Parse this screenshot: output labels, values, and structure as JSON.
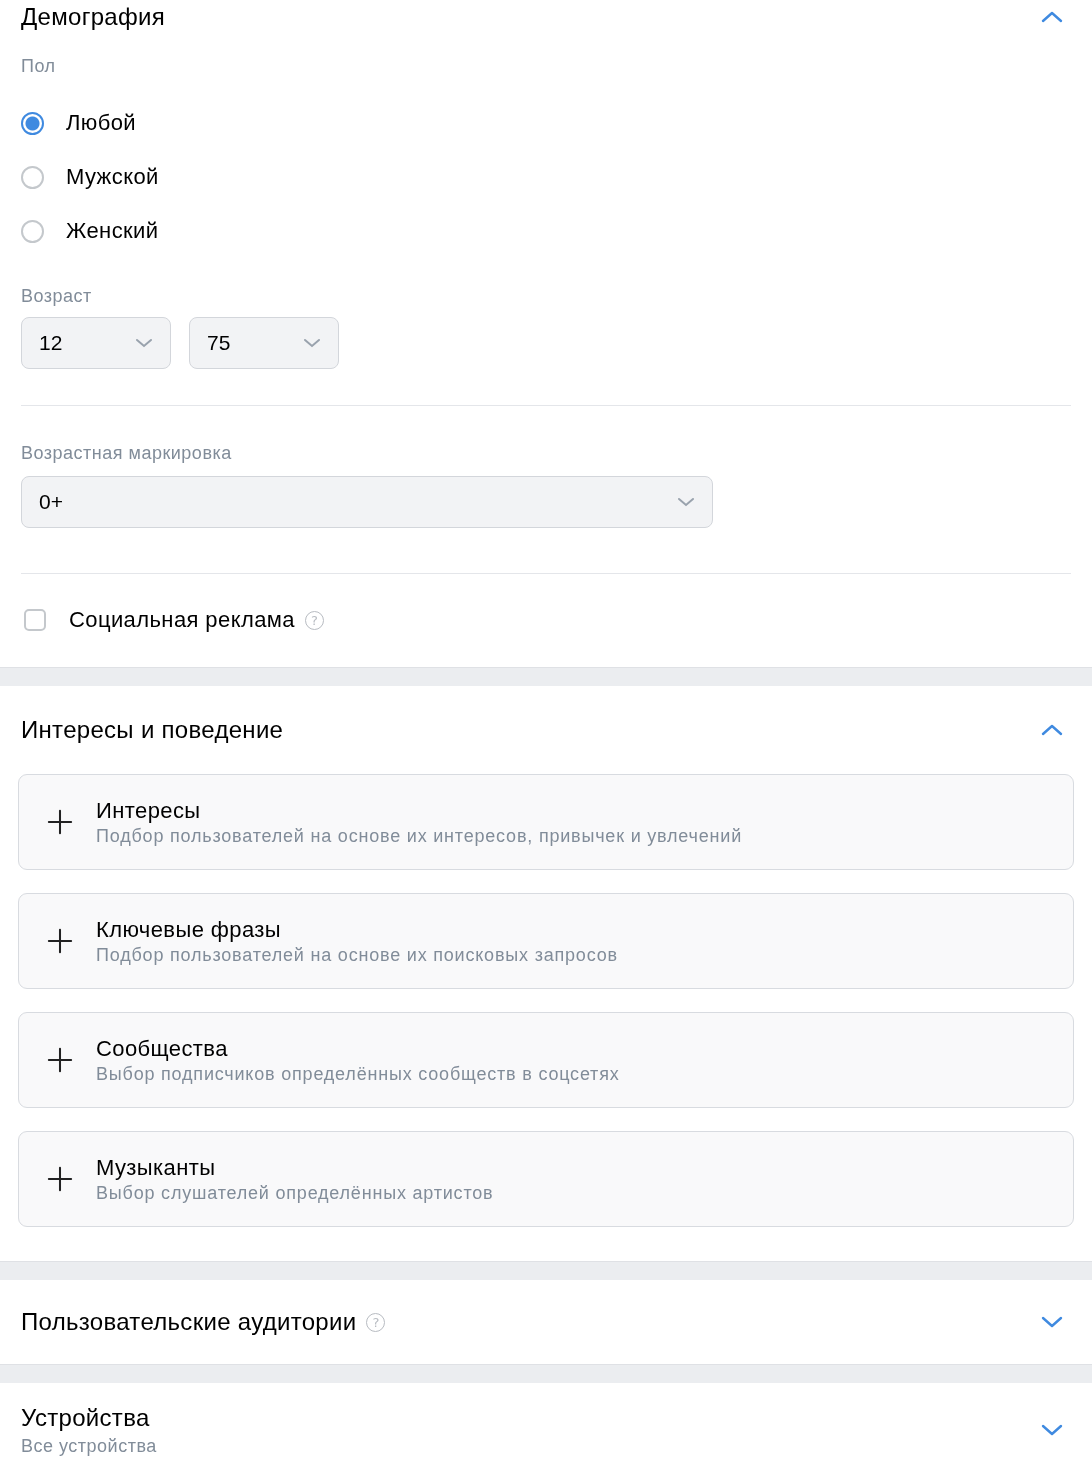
{
  "sections": [
    {
      "kind": "demography",
      "title": "Демография",
      "expanded": true,
      "gender": {
        "label": "Пол",
        "options": [
          {
            "label": "Любой",
            "selected": true
          },
          {
            "label": "Мужской",
            "selected": false
          },
          {
            "label": "Женский",
            "selected": false
          }
        ]
      },
      "age": {
        "label": "Возраст",
        "from": "12",
        "to": "75"
      },
      "age_rating": {
        "label": "Возрастная маркировка",
        "value": "0+"
      },
      "social_ads": {
        "label": "Социальная реклама",
        "checked": false,
        "help": "?"
      }
    },
    {
      "kind": "interests",
      "title": "Интересы и поведение",
      "expanded": true,
      "cards": [
        {
          "title": "Интересы",
          "description": "Подбор пользователей на основе их интересов, привычек и увлечений"
        },
        {
          "title": "Ключевые фразы",
          "description": "Подбор пользователей на основе их поисковых запросов"
        },
        {
          "title": "Сообщества",
          "description": "Выбор подписчиков определённых сообществ в соцсетях"
        },
        {
          "title": "Музыканты",
          "description": "Выбор слушателей определённых артистов"
        }
      ]
    },
    {
      "kind": "audiences",
      "title": "Пользовательские аудитории",
      "expanded": false,
      "help": "?"
    },
    {
      "kind": "devices",
      "title": "Устройства",
      "subtitle": "Все устройства",
      "expanded": false
    }
  ]
}
